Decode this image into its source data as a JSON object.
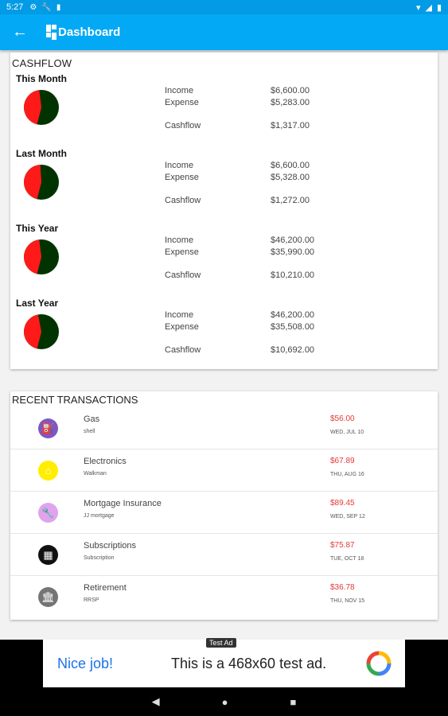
{
  "statusbar": {
    "time": "5:27",
    "icons": [
      "settings-icon",
      "wrench-icon",
      "sd-card-icon"
    ],
    "right_icons": [
      "wifi-icon",
      "signal-icon",
      "battery-icon"
    ]
  },
  "appbar": {
    "back_icon": "arrow-back-icon",
    "title": "Dashboard",
    "title_icon": "dashboard-icon"
  },
  "cashflow": {
    "heading": "CASHFLOW",
    "income_label": "Income",
    "expense_label": "Expense",
    "cashflow_label": "Cashflow",
    "colors": {
      "expense": "#ff1a1a",
      "income": "#003300"
    },
    "periods": [
      {
        "label": "This Month",
        "income": "$6,600.00",
        "expense": "$5,283.00",
        "cashflow": "$1,317.00",
        "expense_ratio": 0.44
      },
      {
        "label": "Last Month",
        "income": "$6,600.00",
        "expense": "$5,328.00",
        "cashflow": "$1,272.00",
        "expense_ratio": 0.45
      },
      {
        "label": "This Year",
        "income": "$46,200.00",
        "expense": "$35,990.00",
        "cashflow": "$10,210.00",
        "expense_ratio": 0.44
      },
      {
        "label": "Last Year",
        "income": "$46,200.00",
        "expense": "$35,508.00",
        "cashflow": "$10,692.00",
        "expense_ratio": 0.43
      }
    ]
  },
  "transactions": {
    "heading": "RECENT TRANSACTIONS",
    "items": [
      {
        "name": "Gas",
        "sub": "shell",
        "amount": "$56.00",
        "date": "WED, JUL 10",
        "icon": "gas-station-icon",
        "color": "#7e57c2",
        "glyph": "⛽"
      },
      {
        "name": "Electronics",
        "sub": "Walkman",
        "amount": "$67.89",
        "date": "THU, AUG 16",
        "icon": "home-icon",
        "color": "#ffee00",
        "glyph": "⌂"
      },
      {
        "name": "Mortgage Insurance",
        "sub": "JJ mortgage",
        "amount": "$89.45",
        "date": "WED, SEP 12",
        "icon": "wrench-icon",
        "color": "#e1a3ec",
        "glyph": "🔧"
      },
      {
        "name": "Subscriptions",
        "sub": "Subscription",
        "amount": "$75.87",
        "date": "TUE, OCT 18",
        "icon": "film-icon",
        "color": "#111111",
        "glyph": "▦"
      },
      {
        "name": "Retirement",
        "sub": "RRSP",
        "amount": "$36.78",
        "date": "THU, NOV 15",
        "icon": "bank-icon",
        "color": "#757575",
        "glyph": "🏛"
      }
    ]
  },
  "ad": {
    "tag": "Test Ad",
    "headline": "Nice job!",
    "text": "This is a 468x60 test ad."
  },
  "navbar": {
    "back": "◀",
    "home": "●",
    "recents": "■"
  }
}
